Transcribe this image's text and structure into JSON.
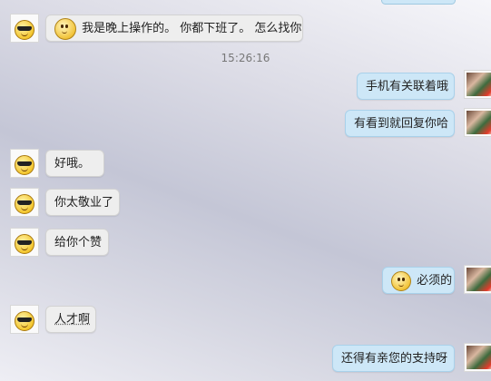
{
  "timestamp": "15:26:16",
  "messages": [
    {
      "side": "left",
      "text": "我是晚上操作的。 你都下班了。 怎么找你",
      "emoji": "dizzy-face"
    },
    {
      "side": "right",
      "text": "手机有关联着哦"
    },
    {
      "side": "right",
      "text": "有看到就回复你哈"
    },
    {
      "side": "left",
      "text": "好哦。"
    },
    {
      "side": "left",
      "text": "你太敬业了"
    },
    {
      "side": "left",
      "text": "给你个赞"
    },
    {
      "side": "right",
      "text": "必须的",
      "emoji": "smile-face"
    },
    {
      "side": "left",
      "text": "人才啊"
    },
    {
      "side": "right",
      "text": "还得有亲您的支持呀"
    }
  ],
  "colors": {
    "left_bubble": "#eeeeee",
    "right_bubble": "#cde7f7"
  }
}
